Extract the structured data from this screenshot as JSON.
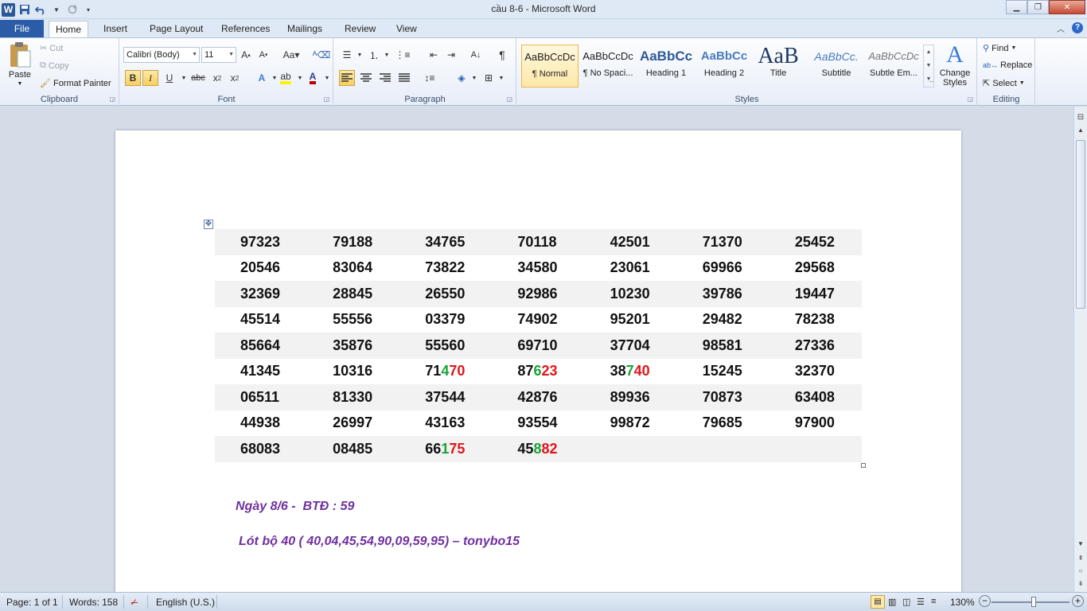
{
  "window": {
    "title": "cầu 8-6  -  Microsoft Word",
    "app_logo": "W"
  },
  "tabs": {
    "file": "File",
    "items": [
      "Home",
      "Insert",
      "Page Layout",
      "References",
      "Mailings",
      "Review",
      "View"
    ],
    "active": "Home"
  },
  "clipboard": {
    "paste": "Paste",
    "cut": "Cut",
    "copy": "Copy",
    "format_painter": "Format Painter",
    "label": "Clipboard"
  },
  "font": {
    "family": "Calibri (Body)",
    "size": "11",
    "label": "Font"
  },
  "paragraph": {
    "label": "Paragraph"
  },
  "styles": {
    "label": "Styles",
    "items": [
      {
        "sample": "AaBbCcDc",
        "name": "¶ Normal"
      },
      {
        "sample": "AaBbCcDc",
        "name": "¶ No Spaci..."
      },
      {
        "sample": "AaBbCc",
        "name": "Heading 1"
      },
      {
        "sample": "AaBbCc",
        "name": "Heading 2"
      },
      {
        "sample": "AaB",
        "name": "Title"
      },
      {
        "sample": "AaBbCc.",
        "name": "Subtitle"
      },
      {
        "sample": "AaBbCcDc",
        "name": "Subtle Em..."
      }
    ],
    "change_styles_line1": "Change",
    "change_styles_line2": "Styles"
  },
  "editing": {
    "label": "Editing",
    "find": "Find",
    "replace": "Replace",
    "select": "Select"
  },
  "document": {
    "rows": [
      [
        "97323",
        "79188",
        "34765",
        "70118",
        "42501",
        "71370",
        "25452"
      ],
      [
        "20546",
        "83064",
        "73822",
        "34580",
        "23061",
        "69966",
        "29568"
      ],
      [
        "32369",
        "28845",
        "26550",
        "92986",
        "10230",
        "39786",
        "19447"
      ],
      [
        "45514",
        "55556",
        "03379",
        "74902",
        "95201",
        "29482",
        "78238"
      ],
      [
        "85664",
        "35876",
        "55560",
        "69710",
        "37704",
        "98581",
        "27336"
      ],
      [
        "41345",
        "10316",
        "71470",
        "87623",
        "38740",
        "15245",
        "32370"
      ],
      [
        "06511",
        "81330",
        "37544",
        "42876",
        "89936",
        "70873",
        "63408"
      ],
      [
        "44938",
        "26997",
        "43163",
        "93554",
        "99872",
        "79685",
        "97900"
      ],
      [
        "68083",
        "08485",
        "66175",
        "45882",
        "",
        "",
        ""
      ]
    ],
    "highlight_colors": {
      "green": "#1aa33a",
      "red": "#e0161b"
    },
    "note1": "Ngày 8/6 -  BTĐ : 59",
    "note2": "Lót bộ 40 ( 40,04,45,54,90,09,59,95) – tonybo15"
  },
  "status": {
    "page": "Page: 1 of 1",
    "words": "Words: 158",
    "language": "English (U.S.)",
    "zoom": "130%"
  }
}
